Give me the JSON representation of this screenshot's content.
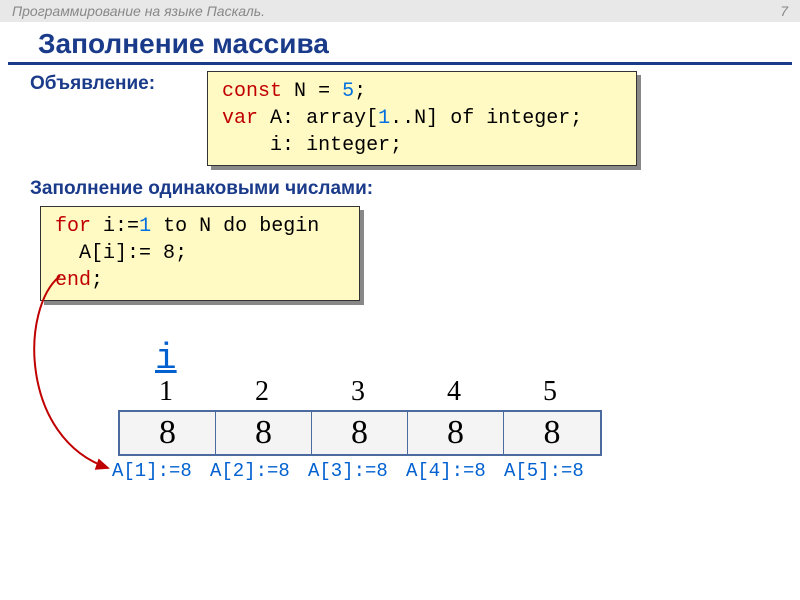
{
  "header": {
    "title": "Программирование на языке Паскаль.",
    "page_number": "7"
  },
  "slide_title": "Заполнение массива",
  "section1_label": "Объявление:",
  "code1": {
    "const": "const",
    "N": "N",
    "eq": "=",
    "five": "5",
    "semi": ";",
    "var": "var",
    "A": "A",
    "colon": ":",
    "array": "array",
    "lb": "[",
    "one": "1",
    "dots": "..",
    "rb": "]",
    "of": "of",
    "integer": "integer",
    "i": "i"
  },
  "section2_label": "Заполнение одинаковыми числами:",
  "code2": {
    "for": "for",
    "i": "i",
    "assign": ":=",
    "one": "1",
    "to": "to",
    "N": "N",
    "do": "do",
    "begin": "begin",
    "Ai": "A[i]:=",
    "eight": "8",
    "semi": ";",
    "end": "end"
  },
  "var_i": "i",
  "indices": [
    "1",
    "2",
    "3",
    "4",
    "5"
  ],
  "cells": [
    "8",
    "8",
    "8",
    "8",
    "8"
  ],
  "assignments": [
    "A[1]:=8",
    "A[2]:=8",
    "A[3]:=8",
    "A[4]:=8",
    "A[5]:=8"
  ]
}
